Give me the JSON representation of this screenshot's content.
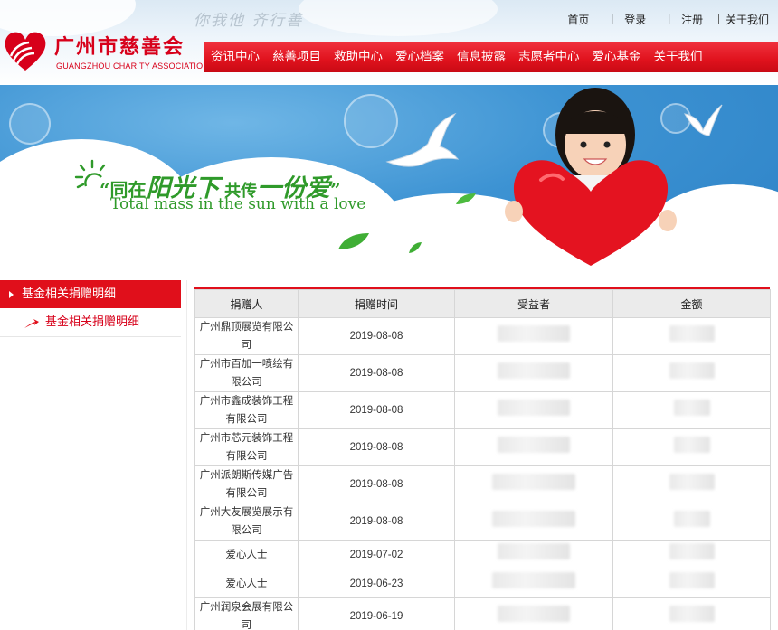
{
  "header": {
    "slogan": "你我他 齐行善",
    "logo": {
      "name_cn": "广州市慈善会",
      "name_en": "GUANGZHOU CHARITY ASSOCIATION"
    },
    "top_links": [
      "首页",
      "登录",
      "注册",
      "关于我们"
    ],
    "nav": [
      "资讯中心",
      "慈善项目",
      "救助中心",
      "爱心档案",
      "信息披露",
      "志愿者中心",
      "爱心基金",
      "关于我们"
    ],
    "accent_color": "#e00f1b"
  },
  "banner": {
    "slogan_cn": [
      "“同在",
      "阳光下",
      "共传",
      "一份爱",
      "”"
    ],
    "slogan_en": "Total mass in the sun with a love"
  },
  "sidebar": {
    "title": "基金相关捐赠明细",
    "items": [
      "基金相关捐赠明细"
    ]
  },
  "table": {
    "columns": [
      "捐赠人",
      "捐赠时间",
      "受益者",
      "金额"
    ],
    "rows": [
      {
        "donor": "广州鼎顶展览有限公司",
        "date": "2019-08-08"
      },
      {
        "donor": "广州市百加一喷绘有限公司",
        "date": "2019-08-08"
      },
      {
        "donor": "广州市鑫成装饰工程有限公司",
        "date": "2019-08-08"
      },
      {
        "donor": "广州市芯元装饰工程有限公司",
        "date": "2019-08-08"
      },
      {
        "donor": "广州派朗斯传媒广告有限公司",
        "date": "2019-08-08"
      },
      {
        "donor": "广州大友展览展示有限公司",
        "date": "2019-08-08"
      },
      {
        "donor": "爱心人士",
        "date": "2019-07-02"
      },
      {
        "donor": "爱心人士",
        "date": "2019-06-23"
      },
      {
        "donor": "广州润泉会展有限公司",
        "date": "2019-06-19"
      }
    ]
  }
}
